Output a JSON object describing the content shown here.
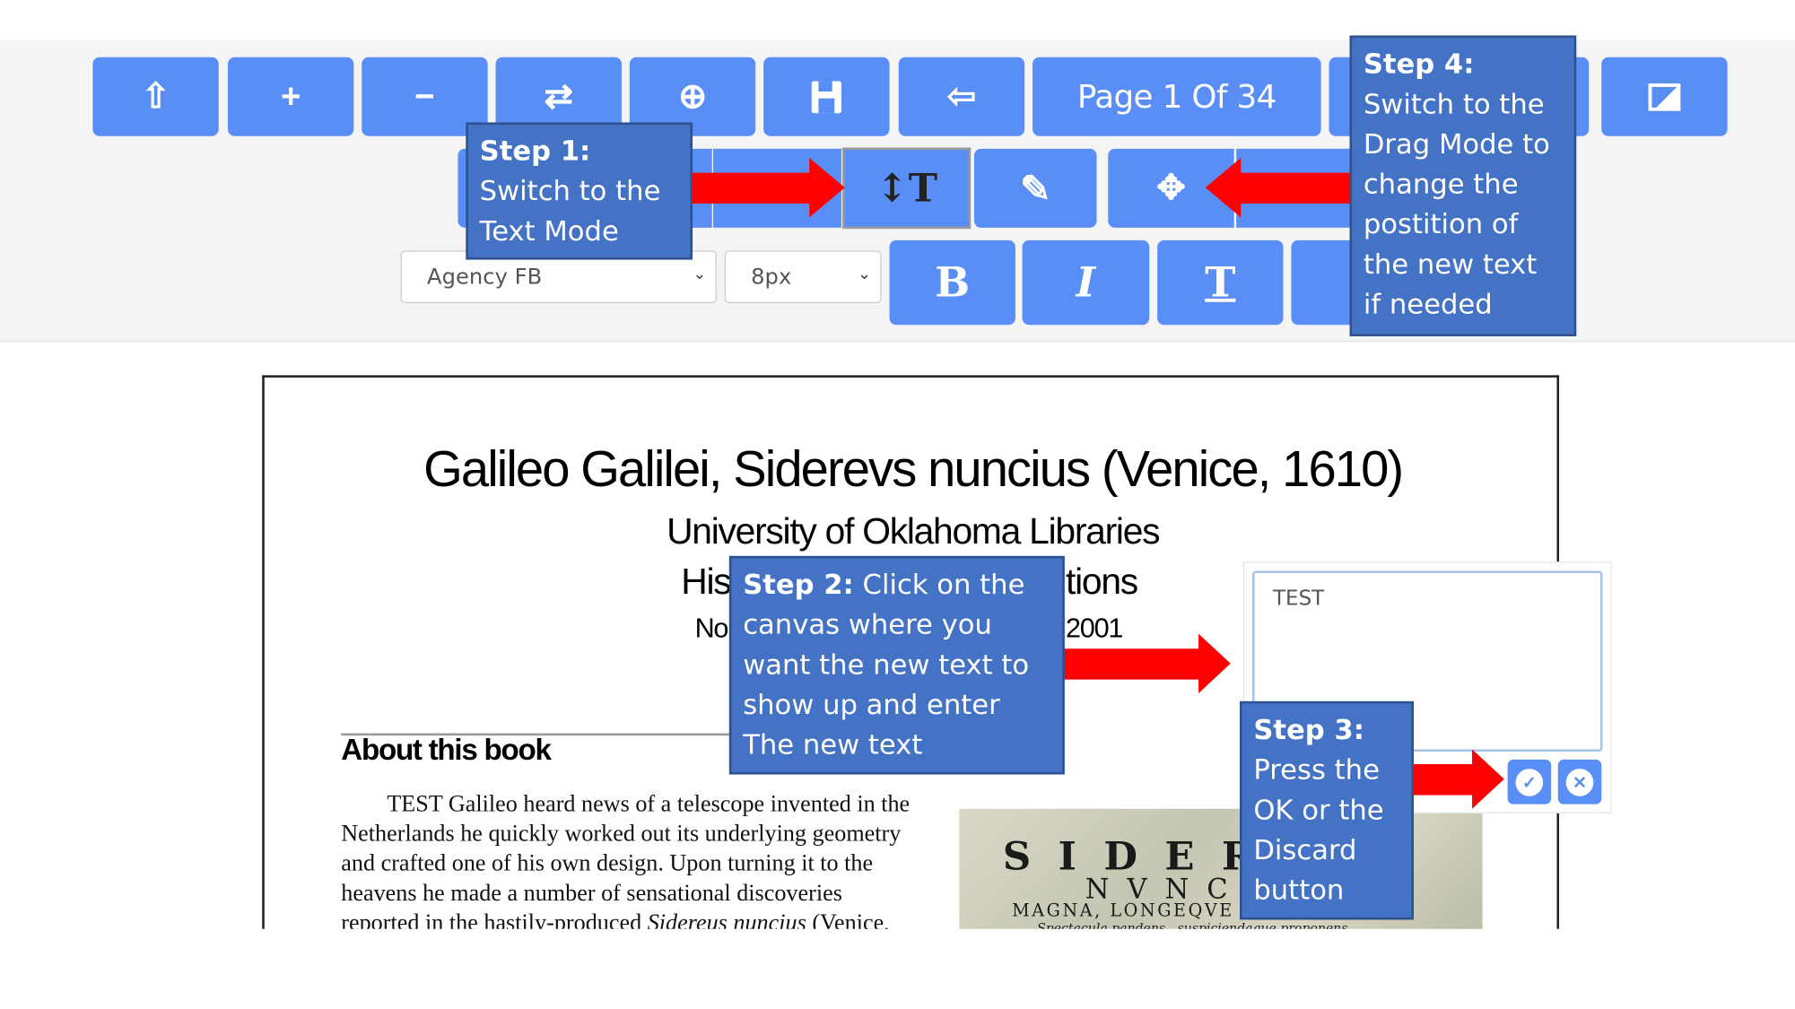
{
  "toolbar": {
    "row1": [
      {
        "name": "upload-button",
        "icon": "arrow-circle-up-icon",
        "glyph": "⇧"
      },
      {
        "name": "zoom-in-button",
        "icon": "plus-icon",
        "glyph": "+"
      },
      {
        "name": "zoom-out-button",
        "icon": "minus-icon",
        "glyph": "−"
      },
      {
        "name": "swap-button",
        "icon": "exchange-icon",
        "glyph": "⇄"
      },
      {
        "name": "add-page-button",
        "icon": "plus-circle-icon",
        "glyph": "⊕"
      },
      {
        "name": "save-button",
        "icon": "floppy-disk-icon",
        "glyph": "💾"
      },
      {
        "name": "back-button",
        "icon": "arrow-circle-left-icon",
        "glyph": "⇦"
      }
    ],
    "page_label": "Page 1 Of 34",
    "image_button_icon": "image-icon",
    "row2": [
      {
        "name": "text-mode-button",
        "icon": "text-cursor-icon",
        "glyph": "↕T"
      },
      {
        "name": "draw-mode-button",
        "icon": "pencil-icon",
        "glyph": "✎"
      },
      {
        "name": "drag-mode-button",
        "icon": "move-arrows-icon",
        "glyph": "✥"
      }
    ],
    "font_select": "Agency FB",
    "size_select": "8px",
    "row3": [
      {
        "name": "bold-button",
        "icon": "bold-icon",
        "glyph": "B"
      },
      {
        "name": "italic-button",
        "icon": "italic-icon",
        "glyph": "I"
      },
      {
        "name": "text-width-button",
        "icon": "text-width-icon",
        "glyph": "T"
      }
    ],
    "accent_color": "#5a8ef7"
  },
  "steps": {
    "step1": {
      "label": "Step 1:",
      "text": "Switch to the Text Mode"
    },
    "step2": {
      "label": "Step 2:",
      "text": "Click on the canvas where you want the new text to show up and enter The new text"
    },
    "step3": {
      "label": "Step 3:",
      "text": "Press the OK or the Discard button"
    },
    "step4": {
      "label": "Step 4:",
      "text": "Switch to the Drag Mode to change the postition of the new text if needed"
    },
    "box_color": "#4472c4",
    "arrow_color": "#ff0000"
  },
  "document": {
    "title": "Galileo Galilei, Siderevs nuncius (Venice, 1610)",
    "subtitle": "University of Oklahoma Libraries",
    "line3_left": "His",
    "line3_right": "tions",
    "line4_left": "No",
    "line4_right": "2001",
    "section_heading": "About this book",
    "paragraph_lines": [
      "TEST Galileo heard news of a telescope invented in the",
      "Netherlands he quickly worked out its underlying geometry",
      "and crafted one of his own design.  Upon turning it to the",
      "heavens he made a number of sensational discoveries",
      "reported in the hastily-produced "
    ],
    "italic_title": "Sidereus nuncius",
    "last_line_end": " (Venice,",
    "image_text": {
      "line1": "S I D E R",
      "line2": "N V N C I",
      "line3": "MAGNA, LONGEQVE A",
      "line4": "Spectacula pandens , suspiciendaque proponens"
    }
  },
  "editor": {
    "value": "TEST",
    "ok_icon": "check-circle-icon",
    "discard_icon": "times-circle-icon"
  }
}
